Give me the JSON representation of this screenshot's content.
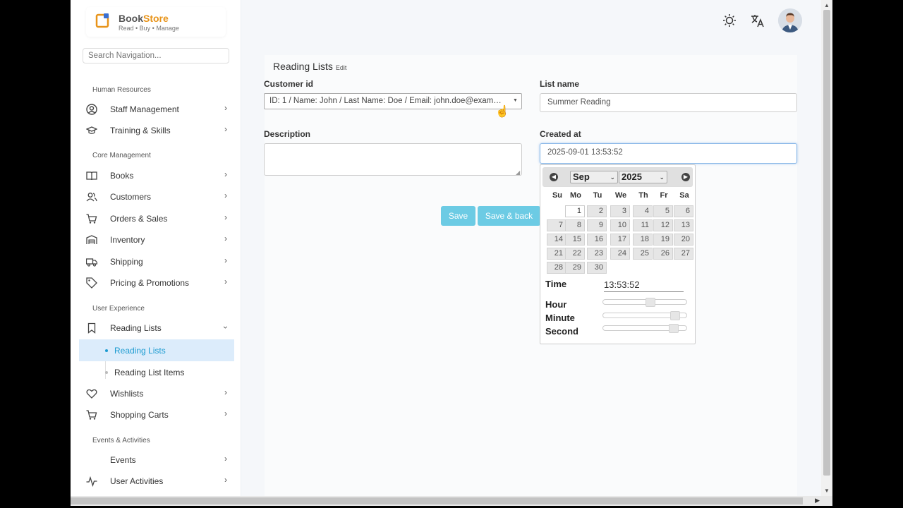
{
  "app": {
    "brand_prefix": "Book",
    "brand_suffix": "Store",
    "tagline": "Read • Buy • Manage",
    "search_placeholder": "Search Navigation..."
  },
  "sidebar": {
    "sections": [
      {
        "title": "Human Resources",
        "items": [
          {
            "label": "Staff Management",
            "icon": "user-circle-icon"
          },
          {
            "label": "Training & Skills",
            "icon": "graduation-cap-icon"
          }
        ]
      },
      {
        "title": "Core Management",
        "items": [
          {
            "label": "Books",
            "icon": "book-open-icon"
          },
          {
            "label": "Customers",
            "icon": "users-icon"
          },
          {
            "label": "Orders & Sales",
            "icon": "cart-icon"
          },
          {
            "label": "Inventory",
            "icon": "warehouse-icon"
          },
          {
            "label": "Shipping",
            "icon": "truck-icon"
          },
          {
            "label": "Pricing & Promotions",
            "icon": "tag-icon"
          }
        ]
      },
      {
        "title": "User Experience",
        "items": [
          {
            "label": "Reading Lists",
            "icon": "bookmark-icon",
            "expanded": true,
            "children": [
              {
                "label": "Reading Lists",
                "active": true
              },
              {
                "label": "Reading List Items",
                "active": false
              }
            ]
          },
          {
            "label": "Wishlists",
            "icon": "heart-icon"
          },
          {
            "label": "Shopping Carts",
            "icon": "cart-icon"
          }
        ]
      },
      {
        "title": "Events & Activities",
        "items": [
          {
            "label": "Events",
            "icon": "calendar-icon"
          },
          {
            "label": "User Activities",
            "icon": "activity-icon"
          }
        ]
      }
    ]
  },
  "topbar": {
    "icons": [
      "sun-icon",
      "translate-icon",
      "avatar"
    ]
  },
  "form": {
    "title": "Reading Lists",
    "title_suffix": "Edit",
    "customer_id_label": "Customer id",
    "customer_id_value": "ID: 1 / Name: John / Last Name: Doe / Email: john.doe@example.com",
    "list_name_label": "List name",
    "list_name_value": "Summer Reading",
    "description_label": "Description",
    "description_value": "",
    "created_at_label": "Created at",
    "created_at_value": "2025-09-01 13:53:52",
    "save_label": "Save",
    "save_back_label": "Save & back"
  },
  "datepicker": {
    "month": "Sep",
    "year": "2025",
    "weekdays": [
      "Su",
      "Mo",
      "Tu",
      "We",
      "Th",
      "Fr",
      "Sa"
    ],
    "first_weekday_index": 1,
    "days_in_month": 30,
    "selected_day": 1,
    "time_label": "Time",
    "time_value": "13:53:52",
    "hour_label": "Hour",
    "minute_label": "Minute",
    "second_label": "Second",
    "hour_level": 0.565,
    "minute_level": 0.898,
    "second_level": 0.881
  },
  "colors": {
    "accent": "#1c9bd1",
    "button": "#6ccbe4",
    "brand_orange": "#e8941a"
  }
}
